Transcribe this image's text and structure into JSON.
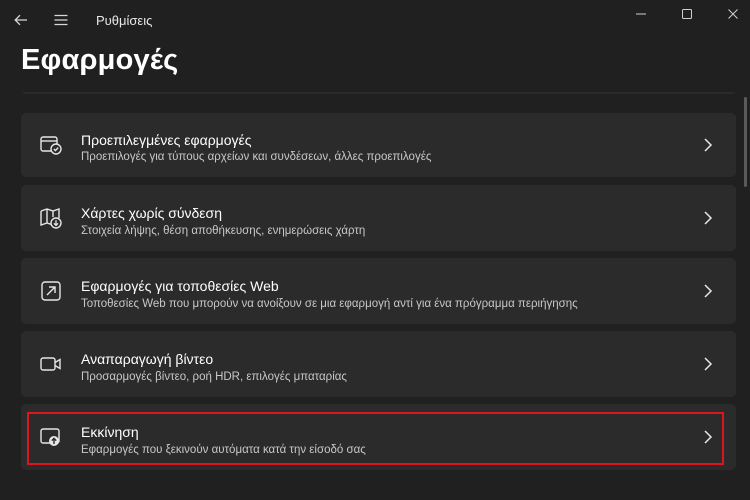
{
  "window": {
    "app_title": "Ρυθμίσεις"
  },
  "page": {
    "title": "Εφαρμογές"
  },
  "items": [
    {
      "title": "Προεπιλεγμένες εφαρμογές",
      "subtitle": "Προεπιλογές για τύπους αρχείων και συνδέσεων, άλλες προεπιλογές",
      "icon": "default-apps-icon"
    },
    {
      "title": "Χάρτες χωρίς σύνδεση",
      "subtitle": "Στοιχεία λήψης, θέση αποθήκευσης, ενημερώσεις χάρτη",
      "icon": "offline-maps-icon"
    },
    {
      "title": "Εφαρμογές για τοποθεσίες Web",
      "subtitle": "Τοποθεσίες Web που μπορούν να ανοίξουν σε μια εφαρμογή αντί για ένα πρόγραμμα περιήγησης",
      "icon": "apps-for-websites-icon"
    },
    {
      "title": "Αναπαραγωγή βίντεο",
      "subtitle": "Προσαρμογές βίντεο, ροή HDR, επιλογές μπαταρίας",
      "icon": "video-playback-icon"
    },
    {
      "title": "Εκκίνηση",
      "subtitle": "Εφαρμογές που ξεκινούν αυτόματα κατά την είσοδό σας",
      "icon": "startup-icon"
    }
  ],
  "colors": {
    "background": "#202020",
    "card": "#2b2b2b",
    "highlight": "#e0141e"
  }
}
